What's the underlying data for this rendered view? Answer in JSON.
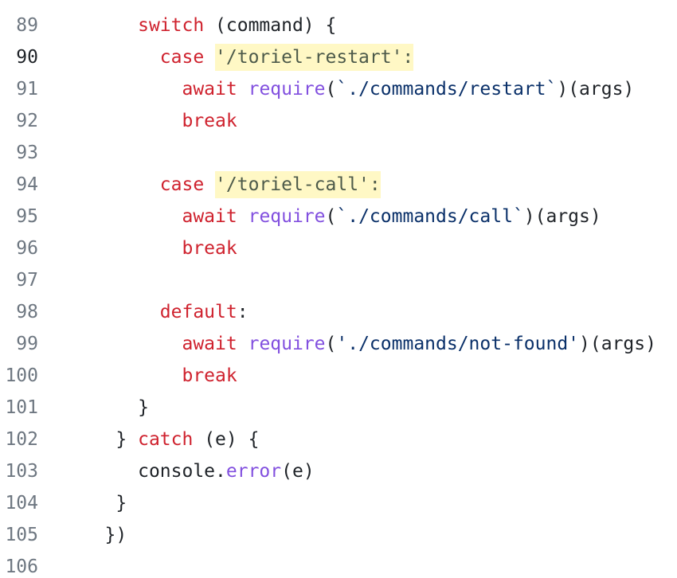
{
  "editor": {
    "active_line": "90",
    "lines": [
      {
        "number": "89",
        "indent": "  ",
        "tokens": [
          {
            "t": "kw",
            "v": "switch"
          },
          {
            "t": "plain",
            "v": " (command) {"
          }
        ]
      },
      {
        "number": "90",
        "indent": "    ",
        "tokens": [
          {
            "t": "kw",
            "v": "case"
          },
          {
            "t": "plain",
            "v": " "
          },
          {
            "t": "hl",
            "v": "'/toriel-restart':"
          }
        ]
      },
      {
        "number": "91",
        "indent": "      ",
        "tokens": [
          {
            "t": "kw",
            "v": "await"
          },
          {
            "t": "plain",
            "v": " "
          },
          {
            "t": "fn",
            "v": "require"
          },
          {
            "t": "plain",
            "v": "("
          },
          {
            "t": "str",
            "v": "`./commands/restart`"
          },
          {
            "t": "plain",
            "v": ")(args)"
          }
        ]
      },
      {
        "number": "92",
        "indent": "      ",
        "tokens": [
          {
            "t": "kw",
            "v": "break"
          }
        ]
      },
      {
        "number": "93",
        "indent": "",
        "tokens": []
      },
      {
        "number": "94",
        "indent": "    ",
        "tokens": [
          {
            "t": "kw",
            "v": "case"
          },
          {
            "t": "plain",
            "v": " "
          },
          {
            "t": "hl",
            "v": "'/toriel-call':"
          }
        ]
      },
      {
        "number": "95",
        "indent": "      ",
        "tokens": [
          {
            "t": "kw",
            "v": "await"
          },
          {
            "t": "plain",
            "v": " "
          },
          {
            "t": "fn",
            "v": "require"
          },
          {
            "t": "plain",
            "v": "("
          },
          {
            "t": "str",
            "v": "`./commands/call`"
          },
          {
            "t": "plain",
            "v": ")(args)"
          }
        ]
      },
      {
        "number": "96",
        "indent": "      ",
        "tokens": [
          {
            "t": "kw",
            "v": "break"
          }
        ]
      },
      {
        "number": "97",
        "indent": "",
        "tokens": []
      },
      {
        "number": "98",
        "indent": "    ",
        "tokens": [
          {
            "t": "kw",
            "v": "default"
          },
          {
            "t": "plain",
            "v": ":"
          }
        ]
      },
      {
        "number": "99",
        "indent": "      ",
        "tokens": [
          {
            "t": "kw",
            "v": "await"
          },
          {
            "t": "plain",
            "v": " "
          },
          {
            "t": "fn",
            "v": "require"
          },
          {
            "t": "plain",
            "v": "("
          },
          {
            "t": "str",
            "v": "'./commands/not-found'"
          },
          {
            "t": "plain",
            "v": ")(args)"
          }
        ]
      },
      {
        "number": "100",
        "indent": "      ",
        "tokens": [
          {
            "t": "kw",
            "v": "break"
          }
        ]
      },
      {
        "number": "101",
        "indent": "  ",
        "tokens": [
          {
            "t": "plain",
            "v": "}"
          }
        ]
      },
      {
        "number": "102",
        "indent": "",
        "tokens": [
          {
            "t": "plain",
            "v": "} "
          },
          {
            "t": "kw",
            "v": "catch"
          },
          {
            "t": "plain",
            "v": " (e) {"
          }
        ]
      },
      {
        "number": "103",
        "indent": "  ",
        "tokens": [
          {
            "t": "plain",
            "v": "console."
          },
          {
            "t": "fn",
            "v": "error"
          },
          {
            "t": "plain",
            "v": "(e)"
          }
        ]
      },
      {
        "number": "104",
        "indent": "",
        "tokens": [
          {
            "t": "plain",
            "v": "}"
          }
        ]
      },
      {
        "number": "105",
        "indent": "",
        "tokens": [
          {
            "t": "plain",
            "v": "})"
          }
        ],
        "outdent": true
      },
      {
        "number": "106",
        "indent": "",
        "tokens": []
      }
    ]
  },
  "colors": {
    "keyword": "#cf222e",
    "function": "#8250df",
    "string": "#0a3069",
    "highlight_bg": "#fff8c5",
    "line_number": "#6e7781"
  }
}
